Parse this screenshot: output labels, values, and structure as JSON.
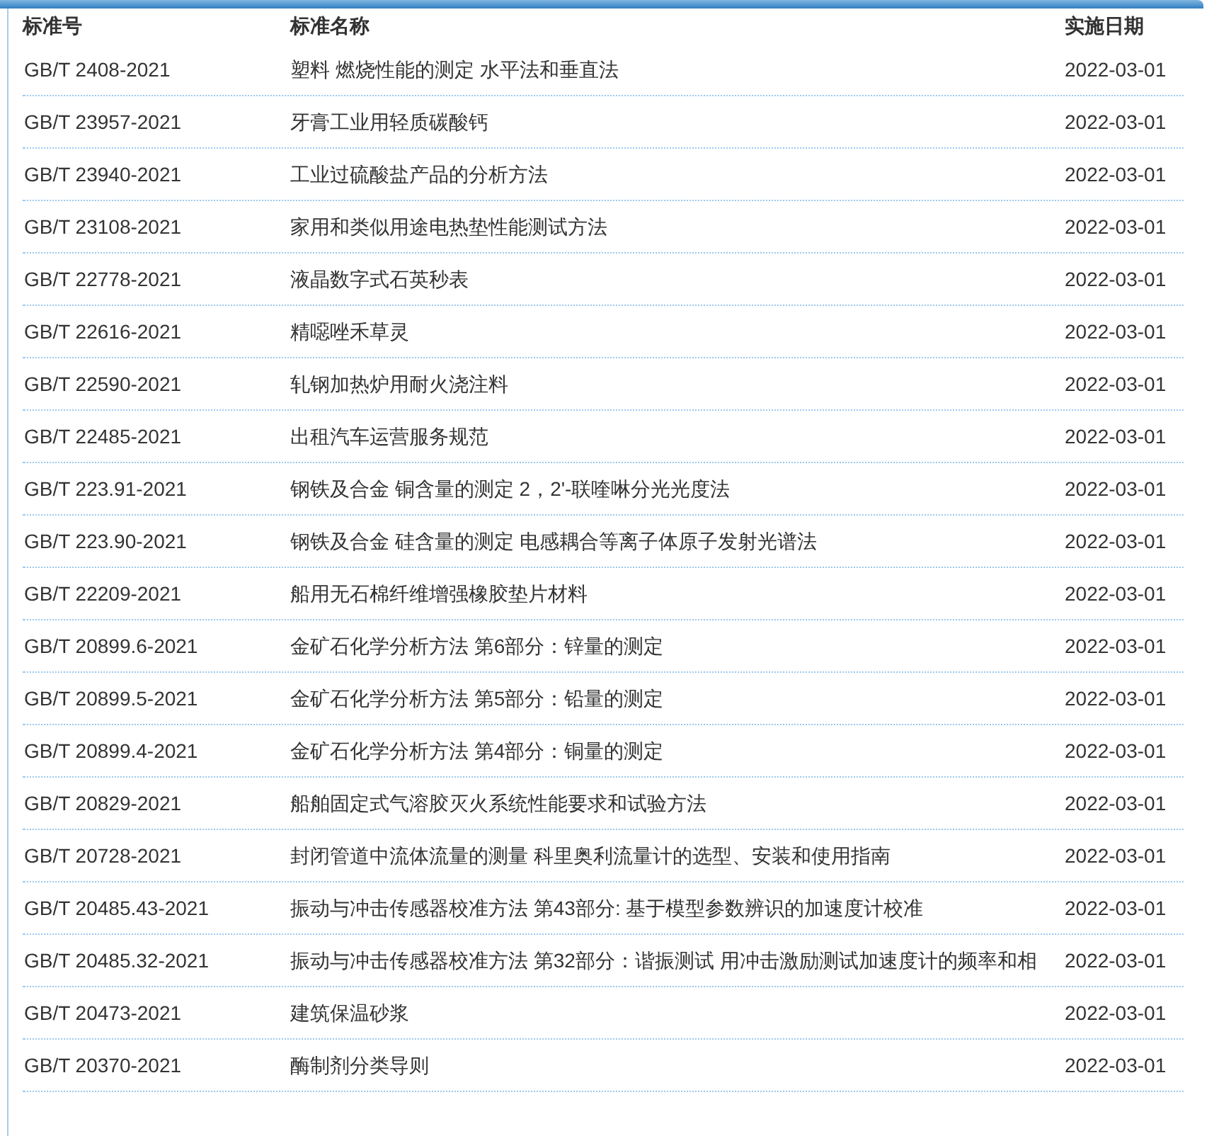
{
  "table": {
    "columns": [
      "标准号",
      "标准名称",
      "实施日期"
    ],
    "rows": [
      [
        "GB/T 2408-2021",
        "塑料 燃烧性能的测定 水平法和垂直法",
        "2022-03-01"
      ],
      [
        "GB/T 23957-2021",
        "牙膏工业用轻质碳酸钙",
        "2022-03-01"
      ],
      [
        "GB/T 23940-2021",
        "工业过硫酸盐产品的分析方法",
        "2022-03-01"
      ],
      [
        "GB/T 23108-2021",
        "家用和类似用途电热垫性能测试方法",
        "2022-03-01"
      ],
      [
        "GB/T 22778-2021",
        "液晶数字式石英秒表",
        "2022-03-01"
      ],
      [
        "GB/T 22616-2021",
        "精噁唑禾草灵",
        "2022-03-01"
      ],
      [
        "GB/T 22590-2021",
        "轧钢加热炉用耐火浇注料",
        "2022-03-01"
      ],
      [
        "GB/T 22485-2021",
        "出租汽车运营服务规范",
        "2022-03-01"
      ],
      [
        "GB/T 223.91-2021",
        "钢铁及合金 铜含量的测定 2，2'-联喹啉分光光度法",
        "2022-03-01"
      ],
      [
        "GB/T 223.90-2021",
        "钢铁及合金 硅含量的测定 电感耦合等离子体原子发射光谱法",
        "2022-03-01"
      ],
      [
        "GB/T 22209-2021",
        "船用无石棉纤维增强橡胶垫片材料",
        "2022-03-01"
      ],
      [
        "GB/T 20899.6-2021",
        "金矿石化学分析方法 第6部分：锌量的测定",
        "2022-03-01"
      ],
      [
        "GB/T 20899.5-2021",
        "金矿石化学分析方法 第5部分：铅量的测定",
        "2022-03-01"
      ],
      [
        "GB/T 20899.4-2021",
        "金矿石化学分析方法 第4部分：铜量的测定",
        "2022-03-01"
      ],
      [
        "GB/T 20829-2021",
        "船舶固定式气溶胶灭火系统性能要求和试验方法",
        "2022-03-01"
      ],
      [
        "GB/T 20728-2021",
        "封闭管道中流体流量的测量 科里奥利流量计的选型、安装和使用指南",
        "2022-03-01"
      ],
      [
        "GB/T 20485.43-2021",
        "振动与冲击传感器校准方法 第43部分: 基于模型参数辨识的加速度计校准",
        "2022-03-01"
      ],
      [
        "GB/T 20485.32-2021",
        "振动与冲击传感器校准方法 第32部分：谐振测试 用冲击激励测试加速度计的频率和相",
        "2022-03-01"
      ],
      [
        "GB/T 20473-2021",
        "建筑保温砂浆",
        "2022-03-01"
      ],
      [
        "GB/T 20370-2021",
        "酶制剂分类导则",
        "2022-03-01"
      ]
    ]
  }
}
